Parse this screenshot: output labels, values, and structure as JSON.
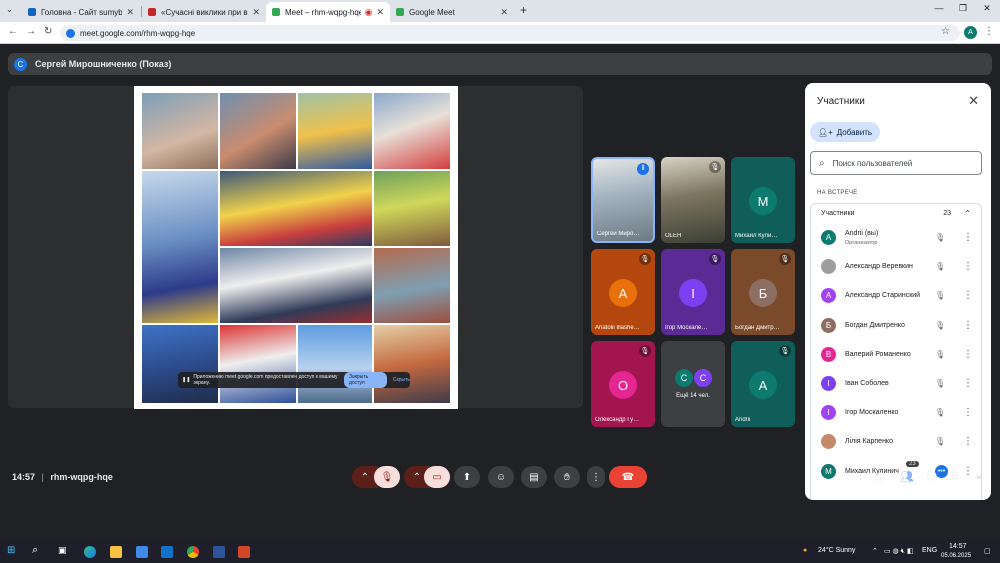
{
  "browser": {
    "tabs": [
      {
        "title": "Головна - Сайт sumybc!",
        "color": "#1565c0",
        "active": false
      },
      {
        "title": "«Сучасні виклики при викла…",
        "color": "#c62828",
        "active": false
      },
      {
        "title": "Meet – rhm-wqpg-hqe",
        "color": "#34a853",
        "active": true
      },
      {
        "title": "Google Meet",
        "color": "#34a853",
        "active": false
      }
    ],
    "url": "meet.google.com/rhm-wqpg-hqe",
    "profile_letter": "A"
  },
  "presenter": {
    "avatar_letter": "С",
    "label": "Сергей Мирошниченко (Показ)"
  },
  "share_notice": {
    "text": "Приложению meet.google.com предоставлен доступ к вашему экрану.",
    "stop_label": "Закрыть доступ",
    "hide_label": "Скрыть"
  },
  "tiles": [
    {
      "name": "Сергей Миро…",
      "letter": "",
      "bg": "#7a8a99",
      "video": true,
      "speaking": true
    },
    {
      "name": "OLEH",
      "letter": "",
      "bg": "#5f6b5a",
      "video": true,
      "muted": true
    },
    {
      "name": "Михаил Кули…",
      "letter": "М",
      "bg": "#0f5e59",
      "avatar": "#0d7a70"
    },
    {
      "name": "Anatolii Illashe…",
      "letter": "А",
      "bg": "#b3470e",
      "avatar": "#e8710a",
      "muted": true
    },
    {
      "name": "Ігор Москале…",
      "letter": "І",
      "bg": "#5b2a94",
      "avatar": "#7e3ff2",
      "muted": true
    },
    {
      "name": "Богдан Дмитр…",
      "letter": "Б",
      "bg": "#7a4a2b",
      "avatar": "#8d6e63",
      "muted": true
    },
    {
      "name": "Олександр Гу…",
      "letter": "О",
      "bg": "#a3154f",
      "avatar": "#e52592",
      "muted": true
    },
    {
      "name": "Ещё 14 чел.",
      "letter": "",
      "bg": "#3c4043",
      "more": [
        "С",
        "С"
      ]
    },
    {
      "name": "Andrii",
      "letter": "А",
      "bg": "#0f5e59",
      "avatar": "#0d7a70",
      "muted": true
    }
  ],
  "panel": {
    "title": "Участники",
    "add_label": "Добавить",
    "search_placeholder": "Поиск пользователей",
    "section": "НА ВСТРЕЧЕ",
    "group_label": "Участники",
    "group_count": "23",
    "participants": [
      {
        "name": "Andrii (вы)",
        "role": "Организатор",
        "letter": "А",
        "color": "#0d7a70"
      },
      {
        "name": "Александр Веревкин",
        "letter": "",
        "color": "#9e9e9e",
        "photo": true
      },
      {
        "name": "Александр Старинский",
        "letter": "А",
        "color": "#a142f4"
      },
      {
        "name": "Богдан Дмитренко",
        "letter": "Б",
        "color": "#8d6e63"
      },
      {
        "name": "Валерий Романенко",
        "letter": "В",
        "color": "#e52592"
      },
      {
        "name": "Іван Соболев",
        "letter": "І",
        "color": "#7e3ff2"
      },
      {
        "name": "Ігор Москаленко",
        "letter": "І",
        "color": "#a142f4"
      },
      {
        "name": "Лілія Карпенко",
        "letter": "",
        "color": "#c48a6a",
        "photo": true
      },
      {
        "name": "Михаил Кулинич",
        "letter": "М",
        "color": "#0d7a70",
        "speaking": true
      }
    ]
  },
  "controls": {
    "time": "14:57",
    "meeting_code": "rhm-wqpg-hqe",
    "participants_badge": "23"
  },
  "taskbar": {
    "weather": "24°C  Sunny",
    "lang": "ENG",
    "time": "14:57",
    "date": "05.06.2025"
  }
}
